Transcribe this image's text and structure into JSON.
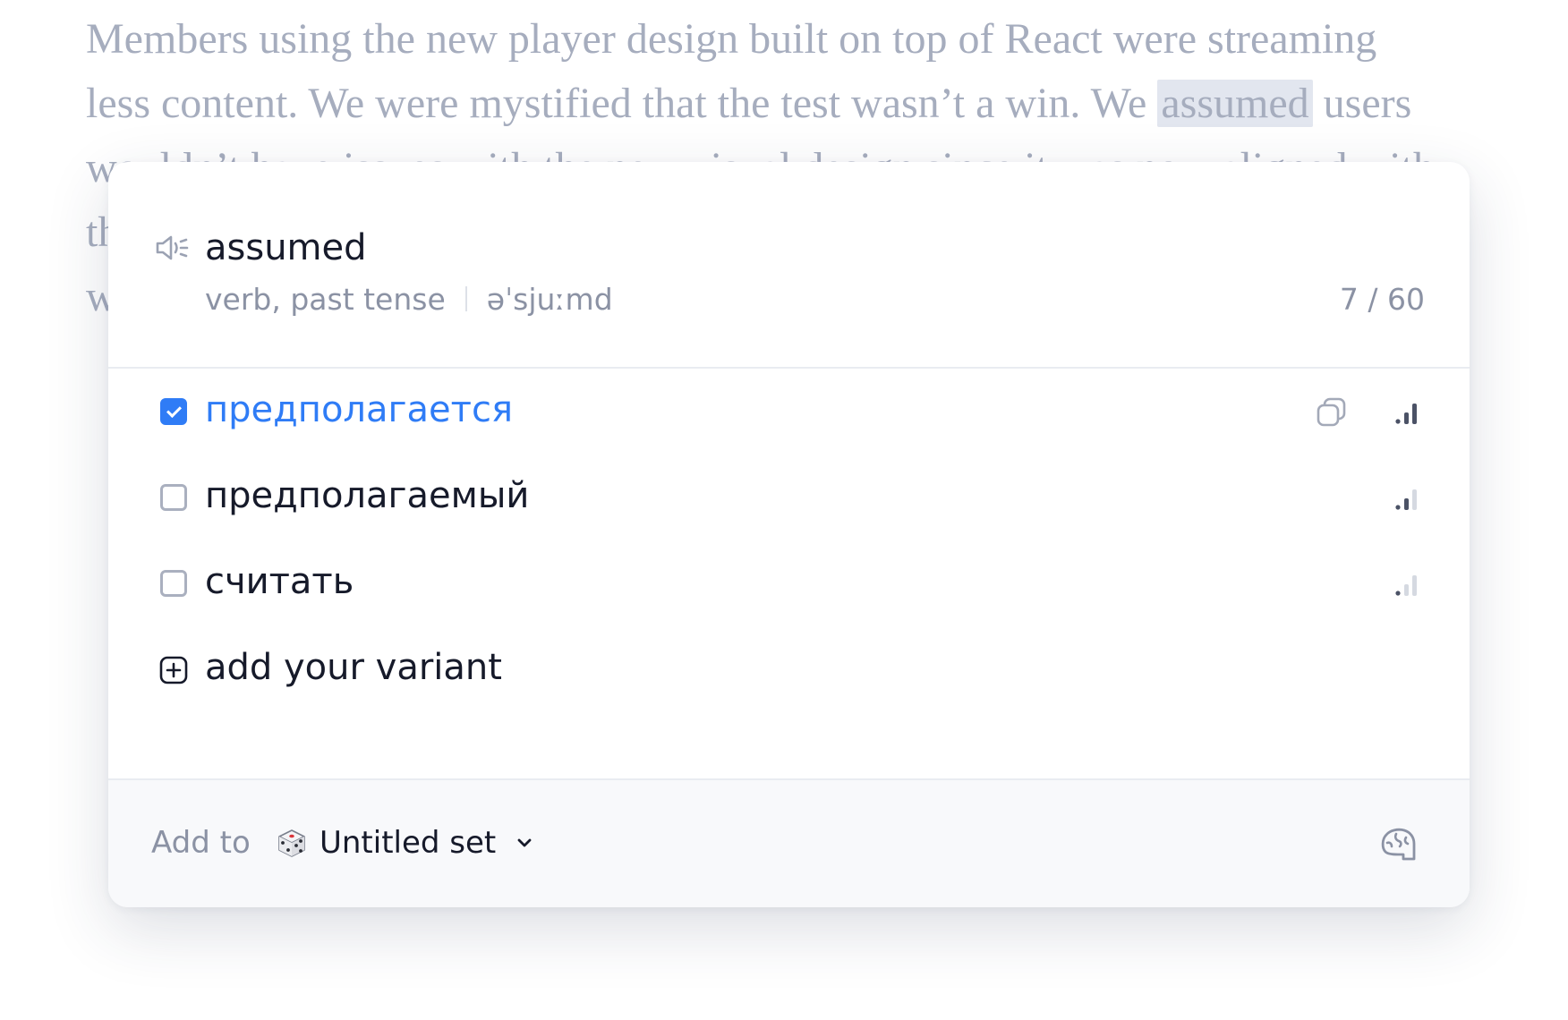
{
  "article": {
    "line1": "Members using the new player design built on top of React were streaming",
    "line2_before": "less content. We were mystified that the test wasn’t a win. We ",
    "line2_highlight": "assumed",
    "line2_after": " users",
    "line3": "wouldn’t have issues with the new visual design since it was now aligned with",
    "line4": "th",
    "line5": "w"
  },
  "popup": {
    "speaker_icon": "speaker-icon",
    "word": "assumed",
    "part_of_speech": "verb, past tense",
    "transcription": "əˈsjuːmd",
    "counter": "7 / 60",
    "variants": [
      {
        "label": "предполагается",
        "checked": true,
        "frequency_level": 3
      },
      {
        "label": "предполагаемый",
        "checked": false,
        "frequency_level": 2
      },
      {
        "label": "считать",
        "checked": false,
        "frequency_level": 1
      }
    ],
    "add_variant_label": "add your variant",
    "footer": {
      "add_to_label": "Add to",
      "set_icon": "dice-icon",
      "set_name": "Untitled set",
      "trainer_icon": "brain-icon"
    }
  },
  "colors": {
    "accent": "#2f7cf6",
    "text_primary": "#161a2a",
    "text_secondary": "#8b92a4",
    "article_text": "#a6adbe",
    "highlight_bg": "#e2e6ef"
  }
}
